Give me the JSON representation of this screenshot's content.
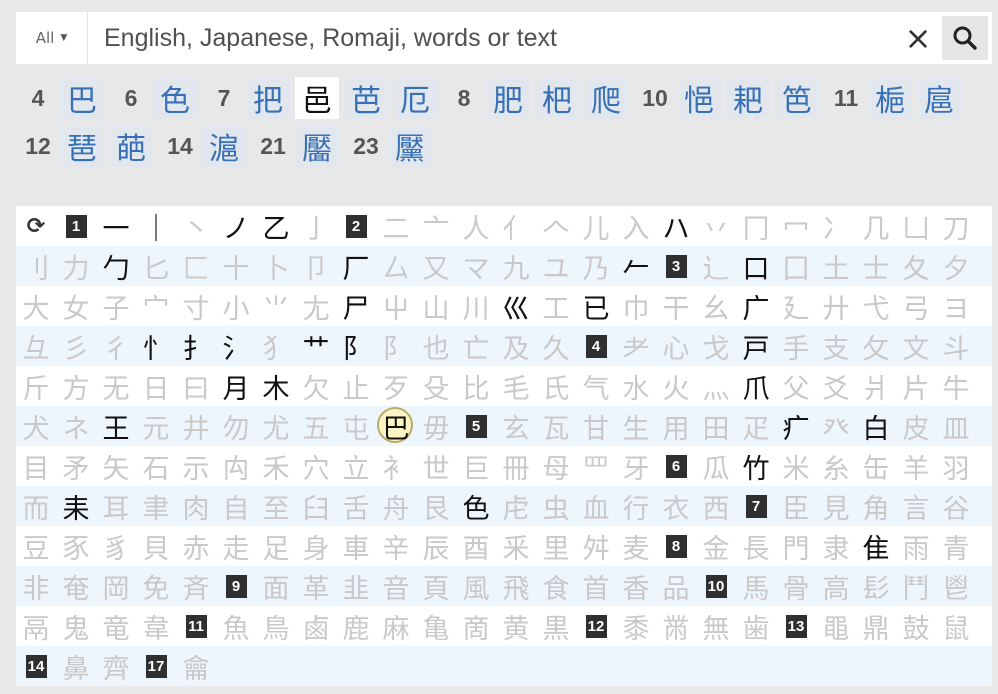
{
  "search": {
    "filter_label": "All",
    "placeholder": "English, Japanese, Romaji, words or text",
    "value": ""
  },
  "results": {
    "rows": [
      [
        {
          "t": "n",
          "v": "4"
        },
        {
          "t": "k",
          "v": "巴"
        },
        {
          "t": "n",
          "v": "6"
        },
        {
          "t": "k",
          "v": "色"
        },
        {
          "t": "n",
          "v": "7"
        },
        {
          "t": "k",
          "v": "把"
        },
        {
          "t": "k",
          "v": "邑",
          "white": true
        },
        {
          "t": "k",
          "v": "芭"
        },
        {
          "t": "k",
          "v": "厄"
        },
        {
          "t": "n",
          "v": "8"
        },
        {
          "t": "k",
          "v": "肥"
        },
        {
          "t": "k",
          "v": "杷"
        },
        {
          "t": "k",
          "v": "爬"
        },
        {
          "t": "n",
          "v": "10"
        },
        {
          "t": "k",
          "v": "悒"
        },
        {
          "t": "k",
          "v": "耙"
        },
        {
          "t": "k",
          "v": "笆"
        },
        {
          "t": "n",
          "v": "11"
        },
        {
          "t": "k",
          "v": "梔"
        },
        {
          "t": "k",
          "v": "扈"
        }
      ],
      [
        {
          "t": "n",
          "v": "12"
        },
        {
          "t": "k",
          "v": "琶"
        },
        {
          "t": "k",
          "v": "葩"
        },
        {
          "t": "n",
          "v": "14"
        },
        {
          "t": "k",
          "v": "滬"
        },
        {
          "t": "n",
          "v": "21"
        },
        {
          "t": "k",
          "v": "靨"
        },
        {
          "t": "n",
          "v": "23"
        },
        {
          "t": "k",
          "v": "黶"
        }
      ]
    ]
  },
  "radicals": {
    "reset_icon": "refresh-icon",
    "rows": [
      [
        {
          "t": "reset"
        },
        {
          "t": "n",
          "v": "1"
        },
        {
          "t": "r",
          "v": "一",
          "on": 1
        },
        {
          "t": "r",
          "v": "｜",
          "on": 1
        },
        {
          "t": "r",
          "v": "丶"
        },
        {
          "t": "r",
          "v": "ノ",
          "on": 1
        },
        {
          "t": "r",
          "v": "乙",
          "on": 1
        },
        {
          "t": "r",
          "v": "亅"
        },
        {
          "t": "n",
          "v": "2"
        },
        {
          "t": "r",
          "v": "二"
        },
        {
          "t": "r",
          "v": "亠"
        },
        {
          "t": "r",
          "v": "人"
        },
        {
          "t": "r",
          "v": "亻"
        },
        {
          "t": "r",
          "v": "𠆢"
        },
        {
          "t": "r",
          "v": "儿"
        },
        {
          "t": "r",
          "v": "入"
        },
        {
          "t": "r",
          "v": "ハ",
          "on": 1
        },
        {
          "t": "r",
          "v": "丷"
        },
        {
          "t": "r",
          "v": "冂"
        },
        {
          "t": "r",
          "v": "冖"
        },
        {
          "t": "r",
          "v": "冫"
        },
        {
          "t": "r",
          "v": "几"
        },
        {
          "t": "r",
          "v": "凵"
        },
        {
          "t": "r",
          "v": "刀"
        }
      ],
      [
        {
          "t": "r",
          "v": "刂"
        },
        {
          "t": "r",
          "v": "力"
        },
        {
          "t": "r",
          "v": "勹",
          "on": 1
        },
        {
          "t": "r",
          "v": "匕"
        },
        {
          "t": "r",
          "v": "匚"
        },
        {
          "t": "r",
          "v": "十"
        },
        {
          "t": "r",
          "v": "卜"
        },
        {
          "t": "r",
          "v": "卩"
        },
        {
          "t": "r",
          "v": "厂",
          "on": 1
        },
        {
          "t": "r",
          "v": "厶"
        },
        {
          "t": "r",
          "v": "又"
        },
        {
          "t": "r",
          "v": "マ"
        },
        {
          "t": "r",
          "v": "九"
        },
        {
          "t": "r",
          "v": "ユ"
        },
        {
          "t": "r",
          "v": "乃"
        },
        {
          "t": "r",
          "v": "𠂉",
          "on": 1
        },
        {
          "t": "n",
          "v": "3"
        },
        {
          "t": "r",
          "v": "⻌"
        },
        {
          "t": "r",
          "v": "口",
          "on": 1
        },
        {
          "t": "r",
          "v": "囗"
        },
        {
          "t": "r",
          "v": "土"
        },
        {
          "t": "r",
          "v": "士"
        },
        {
          "t": "r",
          "v": "夂"
        },
        {
          "t": "r",
          "v": "夕"
        }
      ],
      [
        {
          "t": "r",
          "v": "大"
        },
        {
          "t": "r",
          "v": "女"
        },
        {
          "t": "r",
          "v": "子"
        },
        {
          "t": "r",
          "v": "宀"
        },
        {
          "t": "r",
          "v": "寸"
        },
        {
          "t": "r",
          "v": "小"
        },
        {
          "t": "r",
          "v": "⺌"
        },
        {
          "t": "r",
          "v": "尢"
        },
        {
          "t": "r",
          "v": "尸",
          "on": 1
        },
        {
          "t": "r",
          "v": "屮"
        },
        {
          "t": "r",
          "v": "山"
        },
        {
          "t": "r",
          "v": "川"
        },
        {
          "t": "r",
          "v": "巛",
          "on": 1
        },
        {
          "t": "r",
          "v": "工"
        },
        {
          "t": "r",
          "v": "已",
          "on": 1
        },
        {
          "t": "r",
          "v": "巾"
        },
        {
          "t": "r",
          "v": "干"
        },
        {
          "t": "r",
          "v": "幺"
        },
        {
          "t": "r",
          "v": "广",
          "on": 1
        },
        {
          "t": "r",
          "v": "廴"
        },
        {
          "t": "r",
          "v": "廾"
        },
        {
          "t": "r",
          "v": "弋"
        },
        {
          "t": "r",
          "v": "弓"
        },
        {
          "t": "r",
          "v": "ヨ"
        }
      ],
      [
        {
          "t": "r",
          "v": "彑"
        },
        {
          "t": "r",
          "v": "彡"
        },
        {
          "t": "r",
          "v": "彳"
        },
        {
          "t": "r",
          "v": "忄",
          "on": 1
        },
        {
          "t": "r",
          "v": "扌",
          "on": 1
        },
        {
          "t": "r",
          "v": "氵",
          "on": 1
        },
        {
          "t": "r",
          "v": "犭"
        },
        {
          "t": "r",
          "v": "艹",
          "on": 1
        },
        {
          "t": "r",
          "v": "阝",
          "on": 1
        },
        {
          "t": "r",
          "v": "阝"
        },
        {
          "t": "r",
          "v": "也"
        },
        {
          "t": "r",
          "v": "亡"
        },
        {
          "t": "r",
          "v": "及"
        },
        {
          "t": "r",
          "v": "久"
        },
        {
          "t": "n",
          "v": "4"
        },
        {
          "t": "r",
          "v": "耂"
        },
        {
          "t": "r",
          "v": "心"
        },
        {
          "t": "r",
          "v": "戈"
        },
        {
          "t": "r",
          "v": "戸",
          "on": 1
        },
        {
          "t": "r",
          "v": "手"
        },
        {
          "t": "r",
          "v": "支"
        },
        {
          "t": "r",
          "v": "攵"
        },
        {
          "t": "r",
          "v": "文"
        },
        {
          "t": "r",
          "v": "斗"
        }
      ],
      [
        {
          "t": "r",
          "v": "斤"
        },
        {
          "t": "r",
          "v": "方"
        },
        {
          "t": "r",
          "v": "无"
        },
        {
          "t": "r",
          "v": "日"
        },
        {
          "t": "r",
          "v": "曰"
        },
        {
          "t": "r",
          "v": "月",
          "on": 1
        },
        {
          "t": "r",
          "v": "木",
          "on": 1
        },
        {
          "t": "r",
          "v": "欠"
        },
        {
          "t": "r",
          "v": "止"
        },
        {
          "t": "r",
          "v": "歹"
        },
        {
          "t": "r",
          "v": "殳"
        },
        {
          "t": "r",
          "v": "比"
        },
        {
          "t": "r",
          "v": "毛"
        },
        {
          "t": "r",
          "v": "氏"
        },
        {
          "t": "r",
          "v": "气"
        },
        {
          "t": "r",
          "v": "水"
        },
        {
          "t": "r",
          "v": "火"
        },
        {
          "t": "r",
          "v": "灬"
        },
        {
          "t": "r",
          "v": "爪",
          "on": 1
        },
        {
          "t": "r",
          "v": "父"
        },
        {
          "t": "r",
          "v": "爻"
        },
        {
          "t": "r",
          "v": "爿"
        },
        {
          "t": "r",
          "v": "片"
        },
        {
          "t": "r",
          "v": "牛"
        }
      ],
      [
        {
          "t": "r",
          "v": "犬"
        },
        {
          "t": "r",
          "v": "ネ"
        },
        {
          "t": "r",
          "v": "王",
          "on": 1
        },
        {
          "t": "r",
          "v": "元"
        },
        {
          "t": "r",
          "v": "井"
        },
        {
          "t": "r",
          "v": "勿"
        },
        {
          "t": "r",
          "v": "尤"
        },
        {
          "t": "r",
          "v": "五"
        },
        {
          "t": "r",
          "v": "屯"
        },
        {
          "t": "r",
          "v": "巴",
          "on": 1,
          "sel": 1
        },
        {
          "t": "r",
          "v": "毋"
        },
        {
          "t": "n",
          "v": "5"
        },
        {
          "t": "r",
          "v": "玄"
        },
        {
          "t": "r",
          "v": "瓦"
        },
        {
          "t": "r",
          "v": "甘"
        },
        {
          "t": "r",
          "v": "生"
        },
        {
          "t": "r",
          "v": "用"
        },
        {
          "t": "r",
          "v": "田"
        },
        {
          "t": "r",
          "v": "疋"
        },
        {
          "t": "r",
          "v": "疒",
          "on": 1
        },
        {
          "t": "r",
          "v": "癶"
        },
        {
          "t": "r",
          "v": "白",
          "on": 1
        },
        {
          "t": "r",
          "v": "皮"
        },
        {
          "t": "r",
          "v": "皿"
        }
      ],
      [
        {
          "t": "r",
          "v": "目"
        },
        {
          "t": "r",
          "v": "矛"
        },
        {
          "t": "r",
          "v": "矢"
        },
        {
          "t": "r",
          "v": "石"
        },
        {
          "t": "r",
          "v": "示"
        },
        {
          "t": "r",
          "v": "禸"
        },
        {
          "t": "r",
          "v": "禾"
        },
        {
          "t": "r",
          "v": "穴"
        },
        {
          "t": "r",
          "v": "立"
        },
        {
          "t": "r",
          "v": "衤"
        },
        {
          "t": "r",
          "v": "世"
        },
        {
          "t": "r",
          "v": "巨"
        },
        {
          "t": "r",
          "v": "冊"
        },
        {
          "t": "r",
          "v": "母"
        },
        {
          "t": "r",
          "v": "罒"
        },
        {
          "t": "r",
          "v": "牙"
        },
        {
          "t": "n",
          "v": "6"
        },
        {
          "t": "r",
          "v": "瓜"
        },
        {
          "t": "r",
          "v": "竹",
          "on": 1
        },
        {
          "t": "r",
          "v": "米"
        },
        {
          "t": "r",
          "v": "糸"
        },
        {
          "t": "r",
          "v": "缶"
        },
        {
          "t": "r",
          "v": "羊"
        },
        {
          "t": "r",
          "v": "羽"
        }
      ],
      [
        {
          "t": "r",
          "v": "而"
        },
        {
          "t": "r",
          "v": "耒",
          "on": 1
        },
        {
          "t": "r",
          "v": "耳"
        },
        {
          "t": "r",
          "v": "聿"
        },
        {
          "t": "r",
          "v": "肉"
        },
        {
          "t": "r",
          "v": "自"
        },
        {
          "t": "r",
          "v": "至"
        },
        {
          "t": "r",
          "v": "臼"
        },
        {
          "t": "r",
          "v": "舌"
        },
        {
          "t": "r",
          "v": "舟"
        },
        {
          "t": "r",
          "v": "艮"
        },
        {
          "t": "r",
          "v": "色",
          "on": 1
        },
        {
          "t": "r",
          "v": "虍"
        },
        {
          "t": "r",
          "v": "虫"
        },
        {
          "t": "r",
          "v": "血"
        },
        {
          "t": "r",
          "v": "行"
        },
        {
          "t": "r",
          "v": "衣"
        },
        {
          "t": "r",
          "v": "西"
        },
        {
          "t": "n",
          "v": "7"
        },
        {
          "t": "r",
          "v": "臣"
        },
        {
          "t": "r",
          "v": "見"
        },
        {
          "t": "r",
          "v": "角"
        },
        {
          "t": "r",
          "v": "言"
        },
        {
          "t": "r",
          "v": "谷"
        }
      ],
      [
        {
          "t": "r",
          "v": "豆"
        },
        {
          "t": "r",
          "v": "豕"
        },
        {
          "t": "r",
          "v": "豸"
        },
        {
          "t": "r",
          "v": "貝"
        },
        {
          "t": "r",
          "v": "赤"
        },
        {
          "t": "r",
          "v": "走"
        },
        {
          "t": "r",
          "v": "足"
        },
        {
          "t": "r",
          "v": "身"
        },
        {
          "t": "r",
          "v": "車"
        },
        {
          "t": "r",
          "v": "辛"
        },
        {
          "t": "r",
          "v": "辰"
        },
        {
          "t": "r",
          "v": "酉"
        },
        {
          "t": "r",
          "v": "釆"
        },
        {
          "t": "r",
          "v": "里"
        },
        {
          "t": "r",
          "v": "舛"
        },
        {
          "t": "r",
          "v": "麦"
        },
        {
          "t": "n",
          "v": "8"
        },
        {
          "t": "r",
          "v": "金"
        },
        {
          "t": "r",
          "v": "長"
        },
        {
          "t": "r",
          "v": "門"
        },
        {
          "t": "r",
          "v": "隶"
        },
        {
          "t": "r",
          "v": "隹",
          "on": 1
        },
        {
          "t": "r",
          "v": "雨"
        },
        {
          "t": "r",
          "v": "青"
        }
      ],
      [
        {
          "t": "r",
          "v": "非"
        },
        {
          "t": "r",
          "v": "奄"
        },
        {
          "t": "r",
          "v": "岡"
        },
        {
          "t": "r",
          "v": "免"
        },
        {
          "t": "r",
          "v": "斉"
        },
        {
          "t": "n",
          "v": "9"
        },
        {
          "t": "r",
          "v": "面"
        },
        {
          "t": "r",
          "v": "革"
        },
        {
          "t": "r",
          "v": "韭"
        },
        {
          "t": "r",
          "v": "音"
        },
        {
          "t": "r",
          "v": "頁"
        },
        {
          "t": "r",
          "v": "風"
        },
        {
          "t": "r",
          "v": "飛"
        },
        {
          "t": "r",
          "v": "食"
        },
        {
          "t": "r",
          "v": "首"
        },
        {
          "t": "r",
          "v": "香"
        },
        {
          "t": "r",
          "v": "品"
        },
        {
          "t": "n",
          "v": "10"
        },
        {
          "t": "r",
          "v": "馬"
        },
        {
          "t": "r",
          "v": "骨"
        },
        {
          "t": "r",
          "v": "高"
        },
        {
          "t": "r",
          "v": "髟"
        },
        {
          "t": "r",
          "v": "鬥"
        },
        {
          "t": "r",
          "v": "鬯"
        }
      ],
      [
        {
          "t": "r",
          "v": "鬲"
        },
        {
          "t": "r",
          "v": "鬼"
        },
        {
          "t": "r",
          "v": "竜"
        },
        {
          "t": "r",
          "v": "韋"
        },
        {
          "t": "n",
          "v": "11"
        },
        {
          "t": "r",
          "v": "魚"
        },
        {
          "t": "r",
          "v": "鳥"
        },
        {
          "t": "r",
          "v": "鹵"
        },
        {
          "t": "r",
          "v": "鹿"
        },
        {
          "t": "r",
          "v": "麻"
        },
        {
          "t": "r",
          "v": "亀"
        },
        {
          "t": "r",
          "v": "啇"
        },
        {
          "t": "r",
          "v": "黄"
        },
        {
          "t": "r",
          "v": "黒"
        },
        {
          "t": "n",
          "v": "12"
        },
        {
          "t": "r",
          "v": "黍"
        },
        {
          "t": "r",
          "v": "黹"
        },
        {
          "t": "r",
          "v": "無"
        },
        {
          "t": "r",
          "v": "歯"
        },
        {
          "t": "n",
          "v": "13"
        },
        {
          "t": "r",
          "v": "黽"
        },
        {
          "t": "r",
          "v": "鼎"
        },
        {
          "t": "r",
          "v": "鼓"
        },
        {
          "t": "r",
          "v": "鼠"
        }
      ],
      [
        {
          "t": "n",
          "v": "14"
        },
        {
          "t": "r",
          "v": "鼻"
        },
        {
          "t": "r",
          "v": "齊"
        },
        {
          "t": "n",
          "v": "17"
        },
        {
          "t": "r",
          "v": "龠"
        }
      ]
    ]
  }
}
